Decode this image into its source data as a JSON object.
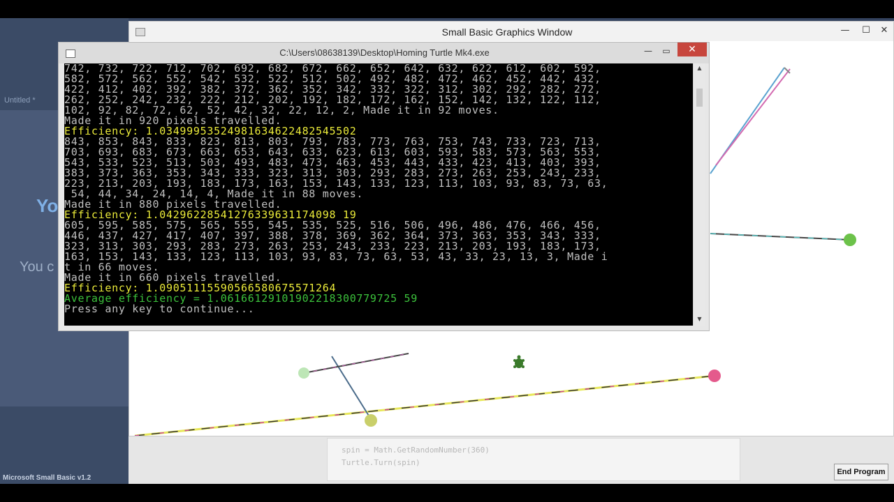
{
  "ide": {
    "untitled_tab": "Untitled *",
    "welcome_big": "Yo",
    "welcome_small": "You c",
    "version": "Microsoft Small Basic v1.2",
    "code_lines": [
      "spin = Math.GetRandomNumber(360)",
      "Turtle.Turn(spin)"
    ],
    "end_program_label": "End Program"
  },
  "graphics_window": {
    "title": "Small Basic Graphics Window",
    "minimize": "—",
    "maximize": "☐",
    "close": "✕"
  },
  "console_window": {
    "title": "C:\\Users\\08638139\\Desktop\\Homing Turtle Mk4.exe",
    "minimize": "—",
    "maximize": "▭",
    "close": "✕",
    "lines": [
      {
        "text": "742, 732, 722, 712, 702, 692, 682, 672, 662, 652, 642, 632, 622, 612, 602, 592,",
        "color": "white"
      },
      {
        "text": "582, 572, 562, 552, 542, 532, 522, 512, 502, 492, 482, 472, 462, 452, 442, 432,",
        "color": "white"
      },
      {
        "text": "422, 412, 402, 392, 382, 372, 362, 352, 342, 332, 322, 312, 302, 292, 282, 272,",
        "color": "white"
      },
      {
        "text": "262, 252, 242, 232, 222, 212, 202, 192, 182, 172, 162, 152, 142, 132, 122, 112,",
        "color": "white"
      },
      {
        "text": "102, 92, 82, 72, 62, 52, 42, 32, 22, 12, 2, Made it in 92 moves.",
        "color": "white"
      },
      {
        "text": "Made it in 920 pixels travelled.",
        "color": "white"
      },
      {
        "text": "Efficiency: 1.03499953524981634622482545502",
        "color": "yellow"
      },
      {
        "text": "843, 853, 843, 833, 823, 813, 803, 793, 783, 773, 763, 753, 743, 733, 723, 713,",
        "color": "white"
      },
      {
        "text": "703, 693, 683, 673, 663, 653, 643, 633, 623, 613, 603, 593, 583, 573, 563, 553,",
        "color": "white"
      },
      {
        "text": "543, 533, 523, 513, 503, 493, 483, 473, 463, 453, 443, 433, 423, 413, 403, 393,",
        "color": "white"
      },
      {
        "text": "383, 373, 363, 353, 343, 333, 323, 313, 303, 293, 283, 273, 263, 253, 243, 233,",
        "color": "white"
      },
      {
        "text": "223, 213, 203, 193, 183, 173, 163, 153, 143, 133, 123, 113, 103, 93, 83, 73, 63,",
        "color": "white"
      },
      {
        "text": " 54, 44, 34, 24, 14, 4, Made it in 88 moves.",
        "color": "white"
      },
      {
        "text": "Made it in 880 pixels travelled.",
        "color": "white"
      },
      {
        "text": "Efficiency: 1.04296228541276339631174098 19",
        "color": "yellow"
      },
      {
        "text": "605, 595, 585, 575, 565, 555, 545, 535, 525, 516, 506, 496, 486, 476, 466, 456,",
        "color": "white"
      },
      {
        "text": "446, 437, 427, 417, 407, 397, 388, 378, 369, 362, 364, 373, 363, 353, 343, 333,",
        "color": "white"
      },
      {
        "text": "323, 313, 303, 293, 283, 273, 263, 253, 243, 233, 223, 213, 203, 193, 183, 173,",
        "color": "white"
      },
      {
        "text": "163, 153, 143, 133, 123, 113, 103, 93, 83, 73, 63, 53, 43, 33, 23, 13, 3, Made i",
        "color": "white"
      },
      {
        "text": "t in 66 moves.",
        "color": "white"
      },
      {
        "text": "Made it in 660 pixels travelled.",
        "color": "white"
      },
      {
        "text": "Efficiency: 1.09051115590566580675571264",
        "color": "yellow"
      },
      {
        "text": "Average efficiency = 1.06166129101902218300779725 59",
        "color": "green"
      },
      {
        "text": "Press any key to continue...",
        "color": "white"
      }
    ]
  },
  "colors": {
    "console_bg": "#000000",
    "console_text": "#c0c0c0",
    "efficiency_text": "#ecec3a",
    "average_text": "#3cc23c",
    "close_button": "#c7463d"
  }
}
